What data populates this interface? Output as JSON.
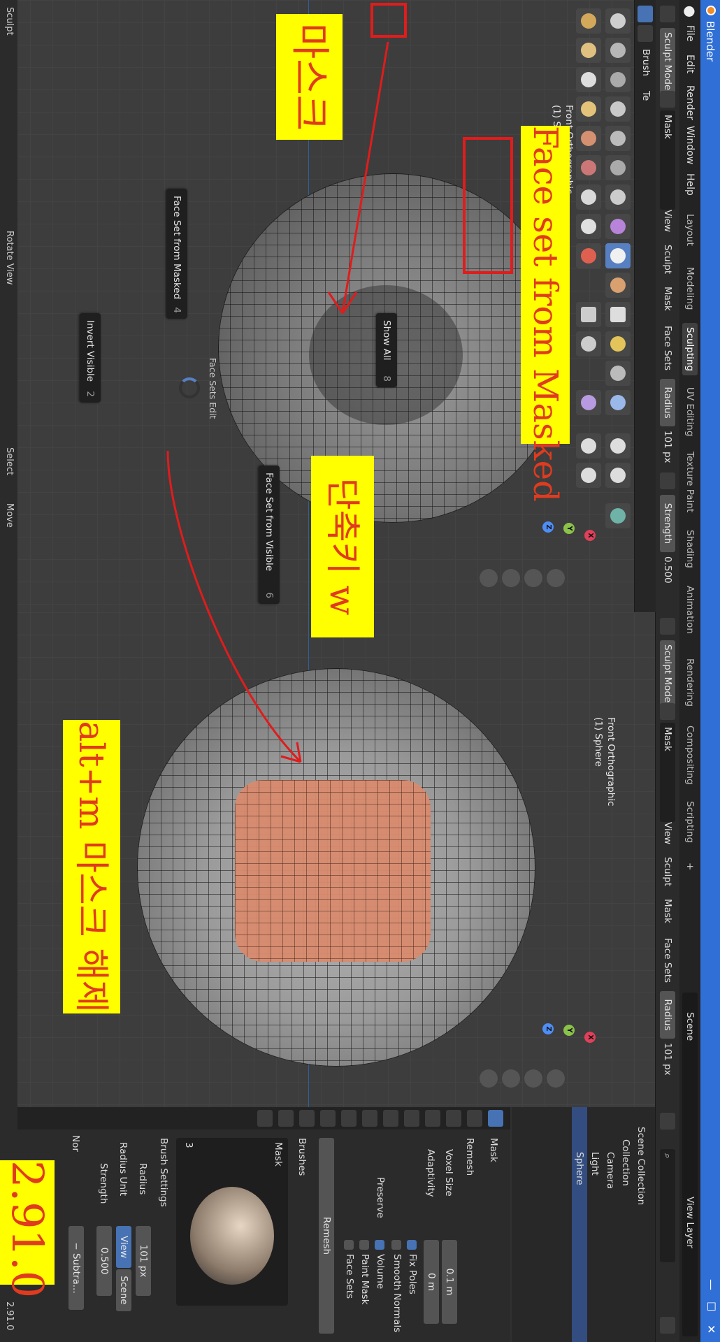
{
  "app": {
    "title": "Blender",
    "version": "2.91.0",
    "controls": {
      "min": "—",
      "max": "☐",
      "close": "✕"
    }
  },
  "menu": {
    "items": [
      "File",
      "Edit",
      "Render",
      "Window",
      "Help"
    ]
  },
  "workspaces": {
    "tabs": [
      "Layout",
      "Modeling",
      "Sculpting",
      "UV Editing",
      "Texture Paint",
      "Shading",
      "Animation",
      "Rendering",
      "Compositing",
      "Scripting"
    ],
    "active": "Sculpting",
    "plus": "+"
  },
  "scene": {
    "label": "Scene",
    "view_layer": "View Layer"
  },
  "header": {
    "mode": "Sculpt Mode",
    "brush": "Mask",
    "menus": [
      "View",
      "Sculpt",
      "Mask",
      "Face Sets"
    ],
    "radius_label": "Radius",
    "radius_value": "101 px",
    "strength_label": "Strength",
    "strength_value": "0.500",
    "brush_label": "Brush",
    "tex_label": "Te"
  },
  "viewport1": {
    "view_name": "Front Orthographic",
    "object": "(1) Sphere"
  },
  "viewport2": {
    "view_name": "Front Orthographic",
    "object": "(1) Sphere"
  },
  "gizmo": {
    "x": "X",
    "y": "Y",
    "z": "Z"
  },
  "pie_menu": {
    "title": "Face Sets Edit",
    "items": [
      {
        "label": "Face Set from Masked",
        "key": "4"
      },
      {
        "label": "Show All",
        "key": "8"
      },
      {
        "label": "Invert Visible",
        "key": "2"
      },
      {
        "label": "Face Set from Visible",
        "key": "6"
      }
    ]
  },
  "annotations": {
    "mask_kr": "마스크",
    "shortcut_kr": "단축키 w",
    "face_set": "Face set from Masked",
    "unmask_kr": "alt+m 마스크 해제",
    "version_big": "2.91.0"
  },
  "outliner": {
    "items": [
      "Scene Collection",
      "Collection",
      "Camera",
      "Light",
      "Sphere"
    ]
  },
  "properties": {
    "tool_name": "Mask",
    "remesh": {
      "title": "Remesh",
      "voxel_size_label": "Voxel Size",
      "voxel_size": "0.1 m",
      "adaptivity_label": "Adaptivity",
      "adaptivity": "0 m",
      "fix_poles": "Fix Poles",
      "smooth_normals": "Smooth Normals",
      "preserve_label": "Preserve",
      "volume": "Volume",
      "paint_mask": "Paint Mask",
      "face_sets": "Face Sets",
      "button": "Remesh"
    },
    "brushes_title": "Brushes",
    "brush_name": "Mask",
    "brush_users": "3",
    "brush_settings_title": "Brush Settings",
    "radius_label": "Radius",
    "radius_value": "101 px",
    "radius_unit_label": "Radius Unit",
    "unit_view": "View",
    "unit_scene": "Scene",
    "strength_label": "Strength",
    "strength_value": "0.500",
    "direction": "− Subtra...",
    "normal_label": "Nor"
  },
  "statusbar": {
    "left": "Sculpt",
    "mid1": "Rotate View",
    "mid2": "Select",
    "mid3": "Move",
    "right": "2.91.0"
  },
  "colors": {
    "title_blue": "#2f6fd6",
    "mask_orange": "#d98b6e",
    "annotation_yellow": "#ffff00",
    "annotation_red": "#e03b1f"
  }
}
